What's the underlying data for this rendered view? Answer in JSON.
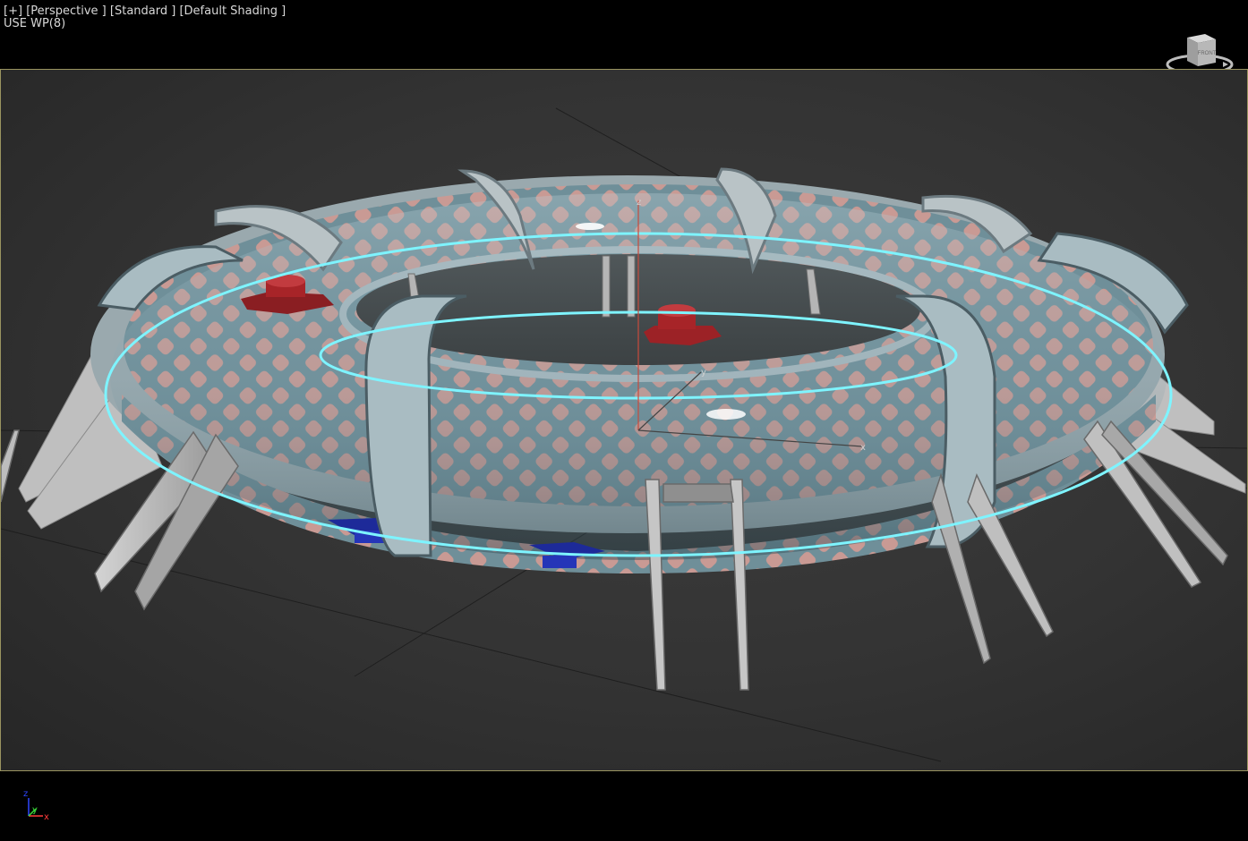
{
  "viewport": {
    "labels": [
      "[+]",
      "[Perspective ]",
      "[Standard ]",
      "[Default Shading ]"
    ],
    "mode_text": "USE WP(8)"
  },
  "viewcube": {
    "face_label": "FRONT"
  },
  "gizmo": {
    "axes": [
      "z",
      "y",
      "x"
    ]
  },
  "corner_tripod": {
    "axes": [
      "z",
      "y",
      "x"
    ]
  },
  "colors": {
    "frame_border": "#9a9460",
    "selection_ring": "#7ef4ff",
    "mesh_tube": "#86a7b4",
    "mesh_interior": "#c08a86",
    "cap_red": "#b3282d",
    "cap_blue": "#2535b8",
    "support": "#c9cacb"
  }
}
